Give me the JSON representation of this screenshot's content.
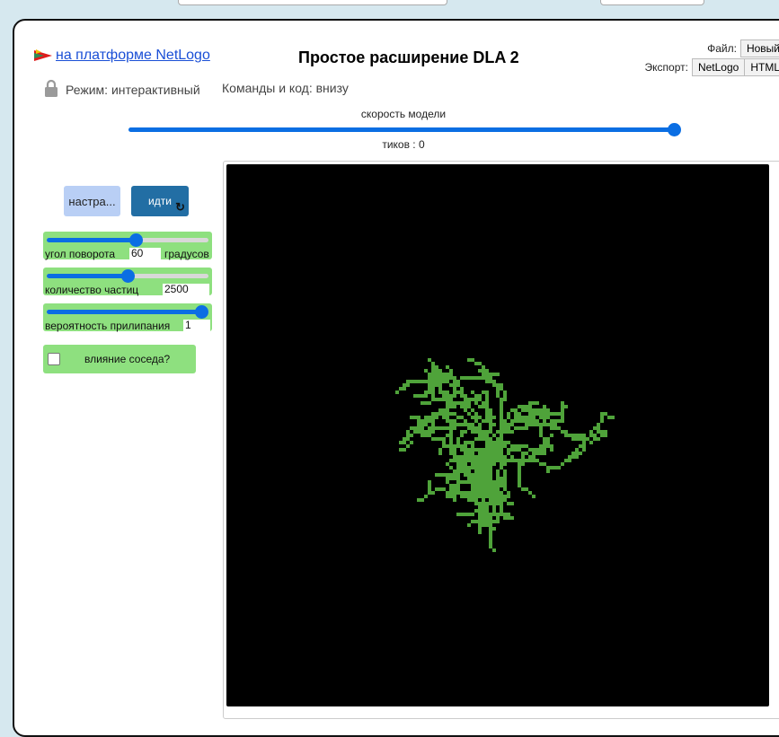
{
  "header": {
    "platform_link": "на платформе NetLogo",
    "title": "Простое расширение DLA 2",
    "file_label": "Файл:",
    "new_button": "Новый",
    "export_label": "Экспорт:",
    "export_netlogo": "NetLogo",
    "export_html": "HTML"
  },
  "mode": {
    "label": "Режим: интерактивный",
    "commands_label": "Команды и код: внизу"
  },
  "speed": {
    "label": "скорость модели",
    "value": 1.0,
    "ticks_text": "тиков : 0"
  },
  "buttons": {
    "setup": "настра...",
    "go": "идти",
    "go_loop_icon": "forever-arrow-icon"
  },
  "sliders": [
    {
      "name": "угол поворота",
      "value": "60",
      "unit": "градусов",
      "level": 0.56
    },
    {
      "name": "количество частиц",
      "value": "2500",
      "unit": "",
      "level": 0.5
    },
    {
      "name": "вероятность прилипания",
      "value": "1",
      "unit": "",
      "level": 1.0
    }
  ],
  "switch": {
    "label": "влияние соседа?",
    "checked": false
  },
  "colors": {
    "slider_bg": "#8ee07f",
    "accent_blue": "#0b6ee3",
    "setup_bg": "#b9cff5",
    "go_bg": "#226ea4",
    "view_bg": "#000000",
    "particle": "#4fa33a"
  }
}
